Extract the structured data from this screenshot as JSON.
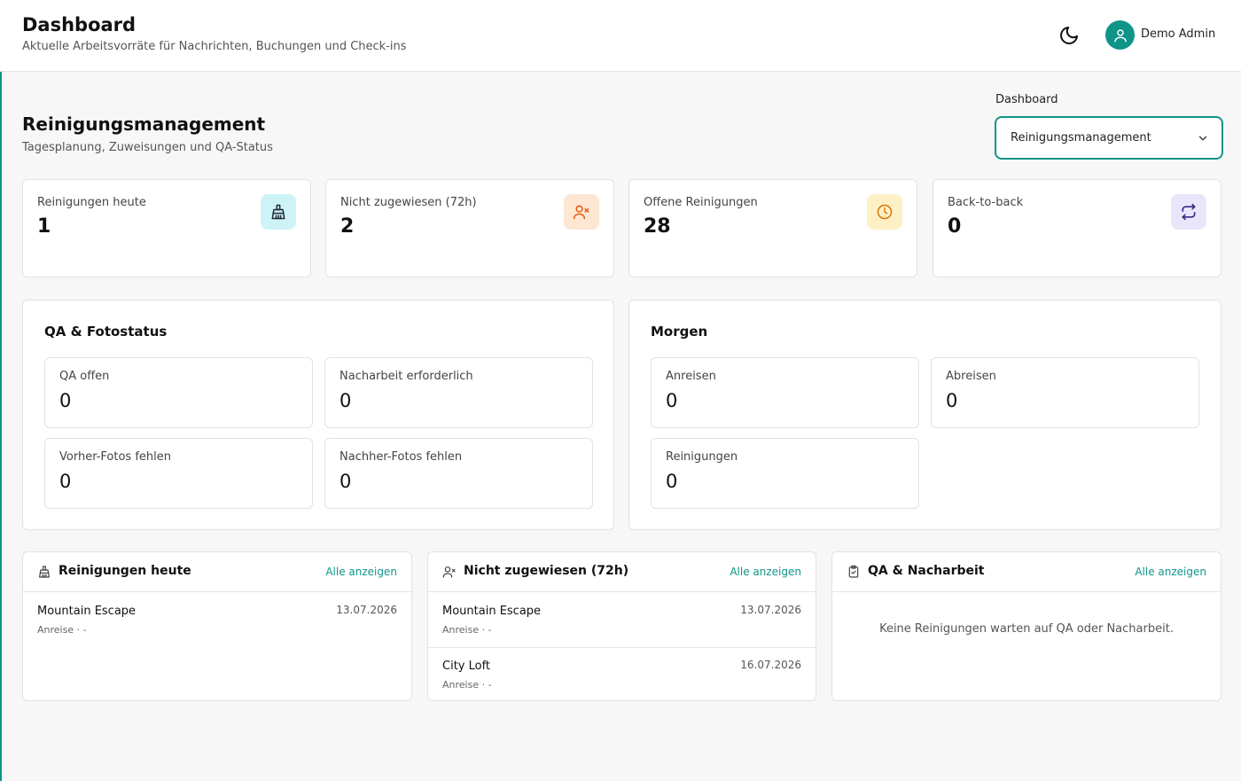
{
  "header": {
    "title": "Dashboard",
    "subtitle": "Aktuelle Arbeitsvorräte für Nachrichten, Buchungen und Check-ins",
    "theme_icon": "moon-icon",
    "user_icon": "user-icon",
    "user_name": "Demo Admin"
  },
  "section": {
    "title": "Reinigungsmanagement",
    "subtitle": "Tagesplanung, Zuweisungen und QA-Status"
  },
  "dashboard_select": {
    "label": "Dashboard",
    "value": "Reinigungsmanagement"
  },
  "stats": [
    {
      "label": "Reinigungen heute",
      "value": "1",
      "icon": "broom-icon",
      "color": "#cdf3f7",
      "icon_color": "#1f2937"
    },
    {
      "label": "Nicht zugewiesen (72h)",
      "value": "2",
      "icon": "user-x-icon",
      "color": "#fde7d3",
      "icon_color": "#ea580c"
    },
    {
      "label": "Offene Reinigungen",
      "value": "28",
      "icon": "clock-icon",
      "color": "#fdf0c4",
      "icon_color": "#d97706"
    },
    {
      "label": "Back-to-back",
      "value": "0",
      "icon": "repeat-icon",
      "color": "#e9e6fb",
      "icon_color": "#312e81"
    }
  ],
  "qa_panel": {
    "title": "QA & Fotostatus",
    "items": [
      {
        "label": "QA offen",
        "value": "0"
      },
      {
        "label": "Nacharbeit erforderlich",
        "value": "0"
      },
      {
        "label": "Vorher-Fotos fehlen",
        "value": "0"
      },
      {
        "label": "Nachher-Fotos fehlen",
        "value": "0"
      }
    ]
  },
  "tomorrow_panel": {
    "title": "Morgen",
    "items": [
      {
        "label": "Anreisen",
        "value": "0"
      },
      {
        "label": "Abreisen",
        "value": "0"
      },
      {
        "label": "Reinigungen",
        "value": "0"
      }
    ]
  },
  "lists": {
    "today": {
      "title": "Reinigungen heute",
      "icon": "broom-icon",
      "link": "Alle anzeigen",
      "rows": [
        {
          "title": "Mountain Escape",
          "sub": "Anreise · -",
          "date": "13.07.2026"
        }
      ]
    },
    "unassigned": {
      "title": "Nicht zugewiesen (72h)",
      "icon": "user-x-icon",
      "link": "Alle anzeigen",
      "rows": [
        {
          "title": "Mountain Escape",
          "sub": "Anreise · -",
          "date": "13.07.2026"
        },
        {
          "title": "City Loft",
          "sub": "Anreise · -",
          "date": "16.07.2026"
        }
      ]
    },
    "qa": {
      "title": "QA & Nacharbeit",
      "icon": "clipboard-check-icon",
      "link": "Alle anzeigen",
      "empty": "Keine Reinigungen warten auf QA oder Nacharbeit."
    }
  },
  "colors": {
    "accent": "#0f9488"
  }
}
